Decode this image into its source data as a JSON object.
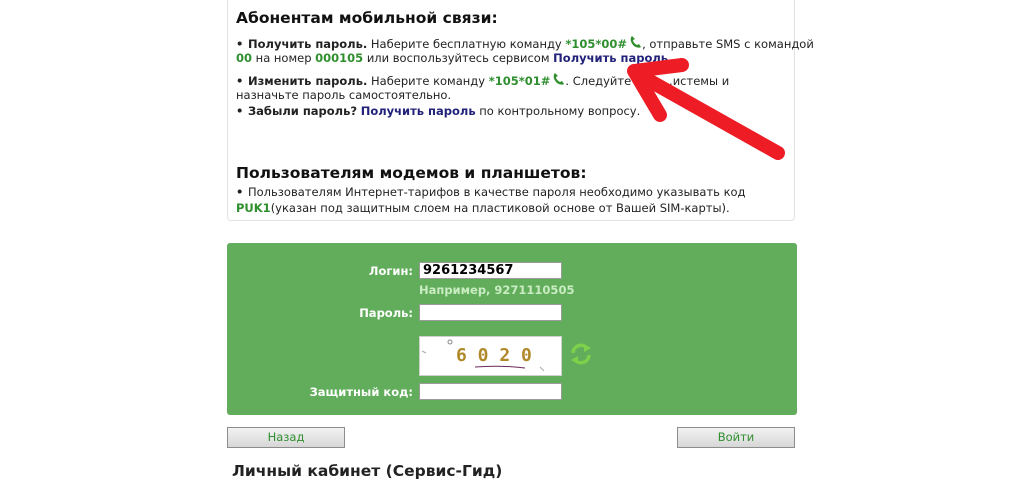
{
  "info": {
    "mobile_heading": "Абонентам мобильной связи:",
    "get_password": {
      "label": "Получить пароль.",
      "text1": " Наберите бесплатную команду ",
      "code": "*105*00#",
      "text2": ", отправьте SMS с командой",
      "sms_code": "00",
      "text3": " на номер ",
      "number": "000105",
      "text4": " или воспользуйтесь сервисом ",
      "link": "Получить пароль",
      "end": "."
    },
    "change_password": {
      "label": "Изменить пароль.",
      "text1": " Наберите команду ",
      "code": "*105*01#",
      "text2": ". Следуйте указ...истемы и",
      "text3": "назначьте пароль самостоятельно."
    },
    "forgot": {
      "label": "Забыли пароль?",
      "link": "Получить пароль",
      "text": " по контрольному вопросу."
    },
    "modem_heading": "Пользователям модемов и планшетов:",
    "modem_text1": "Пользователям Интернет-тарифов в качестве пароля необходимо указывать код",
    "modem_code": "PUK1",
    "modem_text2": "(указан под защитным слоем на пластиковой основе от Вашей SIM-карты)."
  },
  "form": {
    "login_label": "Логин:",
    "login_value": "9261234567",
    "login_hint": "Например, 9271110505",
    "password_label": "Пароль:",
    "password_value": "",
    "captcha_text": "6 0 2 0",
    "security_label": "Защитный код:",
    "security_value": ""
  },
  "buttons": {
    "back": "Назад",
    "login": "Войти"
  },
  "bottom_heading": "Личный кабинет (Сервис-Гид)",
  "colors": {
    "form_bg": "#62ad5b",
    "green_text": "#2f8f2f",
    "link": "#22227a",
    "arrow": "#ee1c25"
  },
  "icons": [
    "phone-icon",
    "refresh-icon",
    "arrow-annotation"
  ]
}
